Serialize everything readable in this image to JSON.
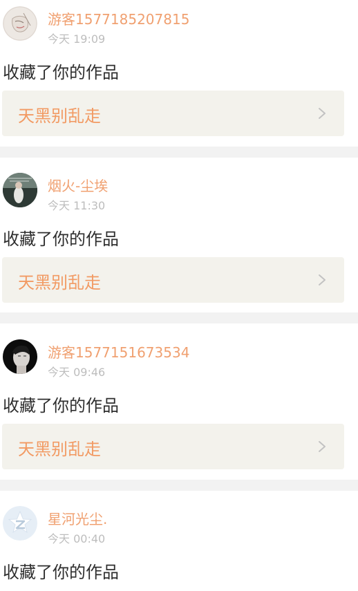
{
  "notifications": [
    {
      "username": "游客1577185207815",
      "time": "今天 19:09",
      "action": "收藏了你的作品",
      "work_title": "天黑别乱走",
      "avatar_icon": "avatar-sketch-icon"
    },
    {
      "username": "烟火-尘埃",
      "time": "今天 11:30",
      "action": "收藏了你的作品",
      "work_title": "天黑别乱走",
      "avatar_icon": "avatar-photo-icon"
    },
    {
      "username": "游客1577151673534",
      "time": "今天 09:46",
      "action": "收藏了你的作品",
      "work_title": "天黑别乱走",
      "avatar_icon": "avatar-portrait-icon"
    },
    {
      "username": "星河光尘.",
      "time": "今天 00:40",
      "action": "收藏了你的作品",
      "avatar_icon": "qq-default-avatar-icon"
    }
  ],
  "colors": {
    "username": "#f0a070",
    "work_title": "#f29a63",
    "time": "#bdbdbd",
    "card_bg": "#f3f2ec",
    "divider": "#f2f2f2"
  }
}
